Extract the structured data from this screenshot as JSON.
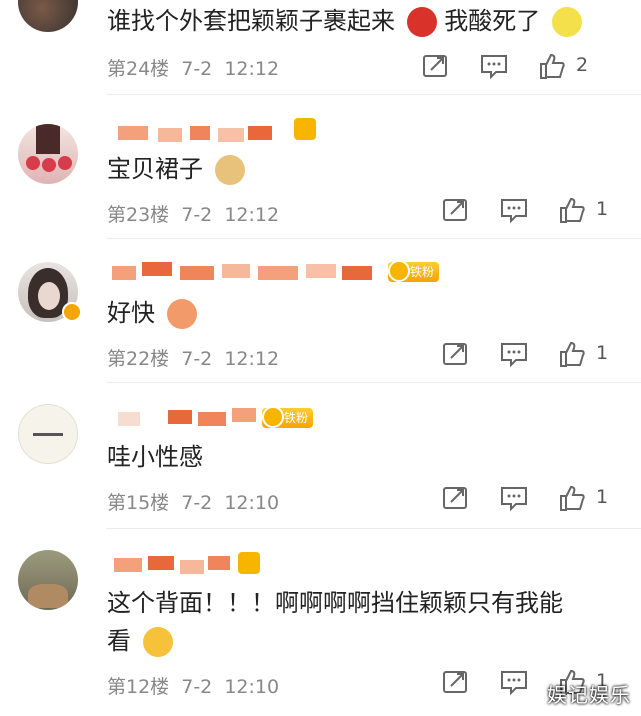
{
  "comments": [
    {
      "text": "谁找个外套把颖颖子裹起来",
      "text2": "我酸死了",
      "floor": "第24楼",
      "date": "7-2",
      "time": "12:12",
      "likes": "2"
    },
    {
      "text": "宝贝裙子",
      "floor": "第23楼",
      "date": "7-2",
      "time": "12:12",
      "likes": "1"
    },
    {
      "text": "好快",
      "floor": "第22楼",
      "date": "7-2",
      "time": "12:12",
      "likes": "1",
      "badge": "铁粉"
    },
    {
      "text": "哇小性感",
      "floor": "第15楼",
      "date": "7-2",
      "time": "12:10",
      "likes": "1",
      "badge": "铁粉"
    },
    {
      "text": "这个背面！！！啊啊啊啊挡住颖颖只有我能",
      "text_line2": "看",
      "floor": "第12楼",
      "date": "7-2",
      "time": "12:10",
      "likes": "1"
    }
  ],
  "watermark": "娱记娱乐",
  "icons": {
    "share": "share-icon",
    "comment": "comment-icon",
    "like": "thumbs-up-icon"
  }
}
